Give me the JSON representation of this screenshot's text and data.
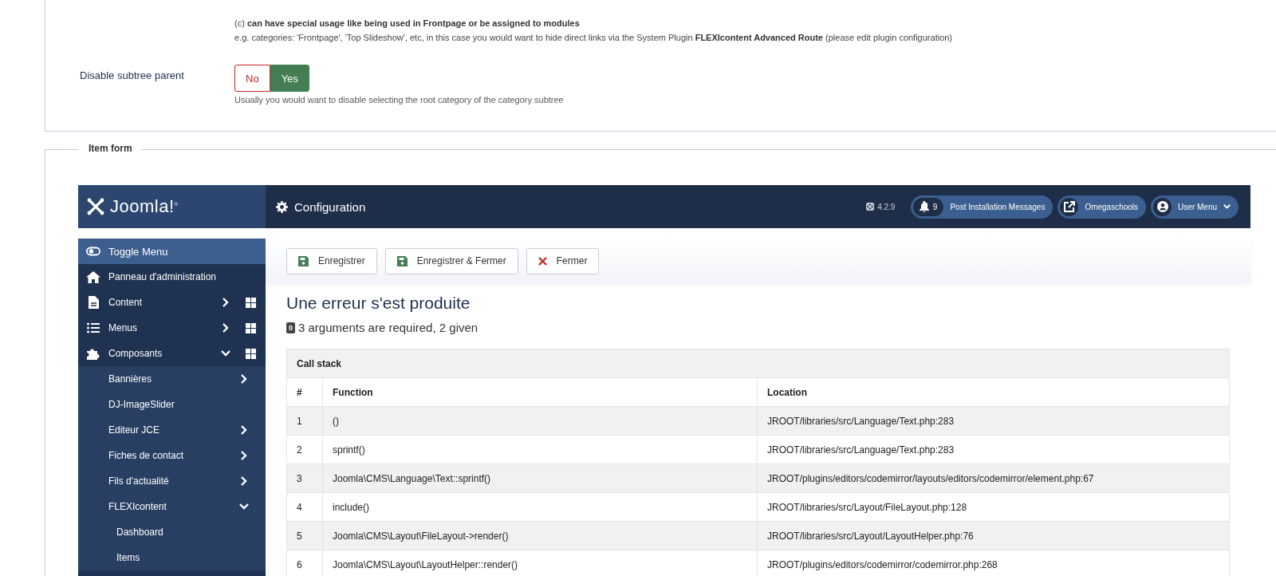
{
  "settings": {
    "note_lines": [
      "(c) **can have special usage like being used in Frontpage or be assigned to modules**",
      "e.g. categories: 'Frontpage', 'Top Slideshow', etc, in this case you would want to hide direct links via the System Plugin **FLEXIcontent Advanced Route** (please edit plugin configuration)"
    ],
    "field": {
      "label": "Disable subtree parent",
      "options": [
        {
          "label": "No",
          "selected": false,
          "color": "#c52827"
        },
        {
          "label": "Yes",
          "selected": true,
          "color": "#457d54"
        }
      ],
      "hint": "Usually you would want to disable selecting the root category of the category subtree"
    }
  },
  "item_form": {
    "legend": "Item form",
    "header": {
      "logo": "Joomla!$^{®}$",
      "title": "Configuration",
      "version": "4.2.9",
      "notifications": {
        "count": "9",
        "label": "Post Installation Messages"
      },
      "site_link": "Omegaschools",
      "user_menu": "User Menu"
    },
    "sidebar": {
      "items": [
        {
          "label": "Toggle Menu",
          "selected": true,
          "dashboard": false
        },
        {
          "label": "Panneau d'administration",
          "selected": false,
          "dashboard": false
        },
        {
          "label": "Content",
          "selected": false,
          "expanded": false,
          "dashboard": true
        },
        {
          "label": "Menus",
          "selected": false,
          "expanded": false,
          "dashboard": true
        },
        {
          "label": "Composants",
          "selected": false,
          "expanded": true,
          "dashboard": true,
          "children": [
            {
              "label": "Bannières",
              "expanded": false
            },
            {
              "label": "DJ-ImageSlider"
            },
            {
              "label": "Editeur JCE",
              "expanded": false
            },
            {
              "label": "Fiches de contact",
              "expanded": false
            },
            {
              "label": "Fils d'actualité",
              "expanded": false
            },
            {
              "label": "FLEXIcontent",
              "expanded": true,
              "children": [
                {
                  "label": "Dashboard"
                },
                {
                  "label": "Items"
                }
              ]
            }
          ]
        }
      ]
    },
    "toolbar": [
      {
        "label": "Enregistrer",
        "kind": "save"
      },
      {
        "label": "Enregistrer & Fermer",
        "kind": "save"
      },
      {
        "label": "Fermer",
        "kind": "close"
      }
    ],
    "error": {
      "title": "Une erreur s'est produite",
      "code": "0",
      "message": "3 arguments are required, 2 given"
    },
    "table": {
      "caption": "Call stack",
      "columns": [
        "#",
        "Function",
        "Location"
      ],
      "rows": [
        [
          "1",
          "()",
          "JROOT/libraries/src/Language/Text.php:283"
        ],
        [
          "2",
          "sprintf()",
          "JROOT/libraries/src/Language/Text.php:283"
        ],
        [
          "3",
          "Joomla\\CMS\\Language\\Text::sprintf()",
          "JROOT/plugins/editors/codemirror/layouts/editors/codemirror/element.php:67"
        ],
        [
          "4",
          "include()",
          "JROOT/libraries/src/Layout/FileLayout.php:128"
        ],
        [
          "5",
          "Joomla\\CMS\\Layout\\FileLayout->render()",
          "JROOT/libraries/src/Layout/LayoutHelper.php:76"
        ],
        [
          "6",
          "Joomla\\CMS\\Layout\\LayoutHelper::render()",
          "JROOT/plugins/editors/codemirror/codemirror.php:268"
        ]
      ]
    }
  }
}
